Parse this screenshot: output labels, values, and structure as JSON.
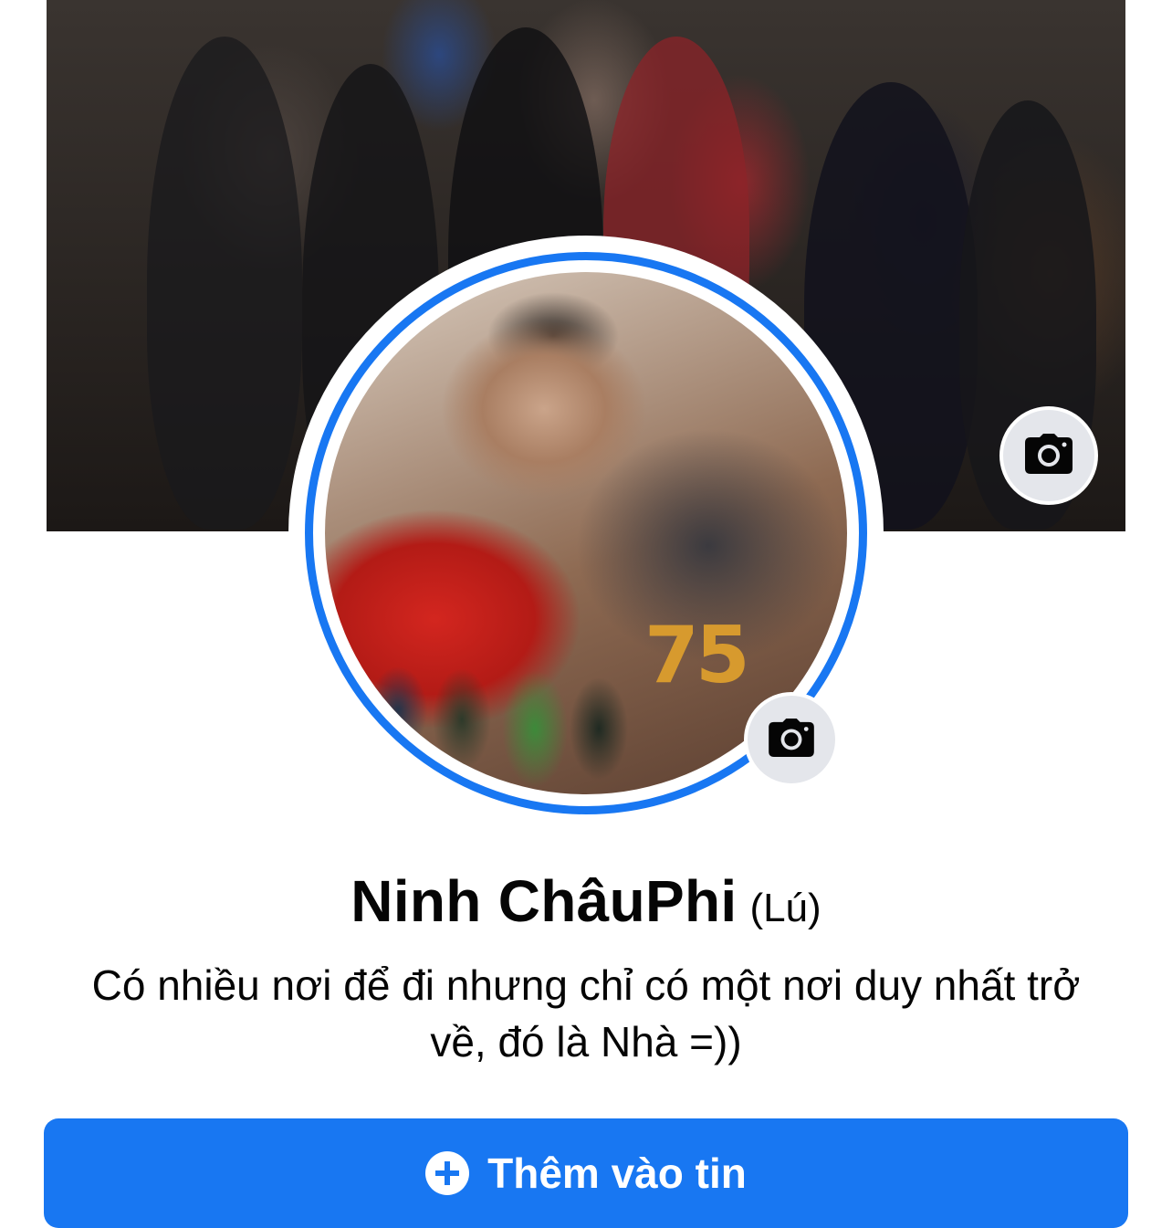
{
  "profile": {
    "name": "Ninh ChâuPhi",
    "alternate_name": "(Lú)",
    "bio": "Có nhiều nơi để đi nhưng chỉ có một nơi duy nhất trở về, đó là Nhà =))"
  },
  "cover_photo": {
    "icon": "camera-icon"
  },
  "profile_picture": {
    "icon": "camera-icon",
    "ring_color": "#1877f2",
    "overlay_text": "75"
  },
  "actions": {
    "add_story_label": "Thêm vào tin",
    "add_story_icon": "plus-circle-icon",
    "accent_color": "#1877f2"
  }
}
